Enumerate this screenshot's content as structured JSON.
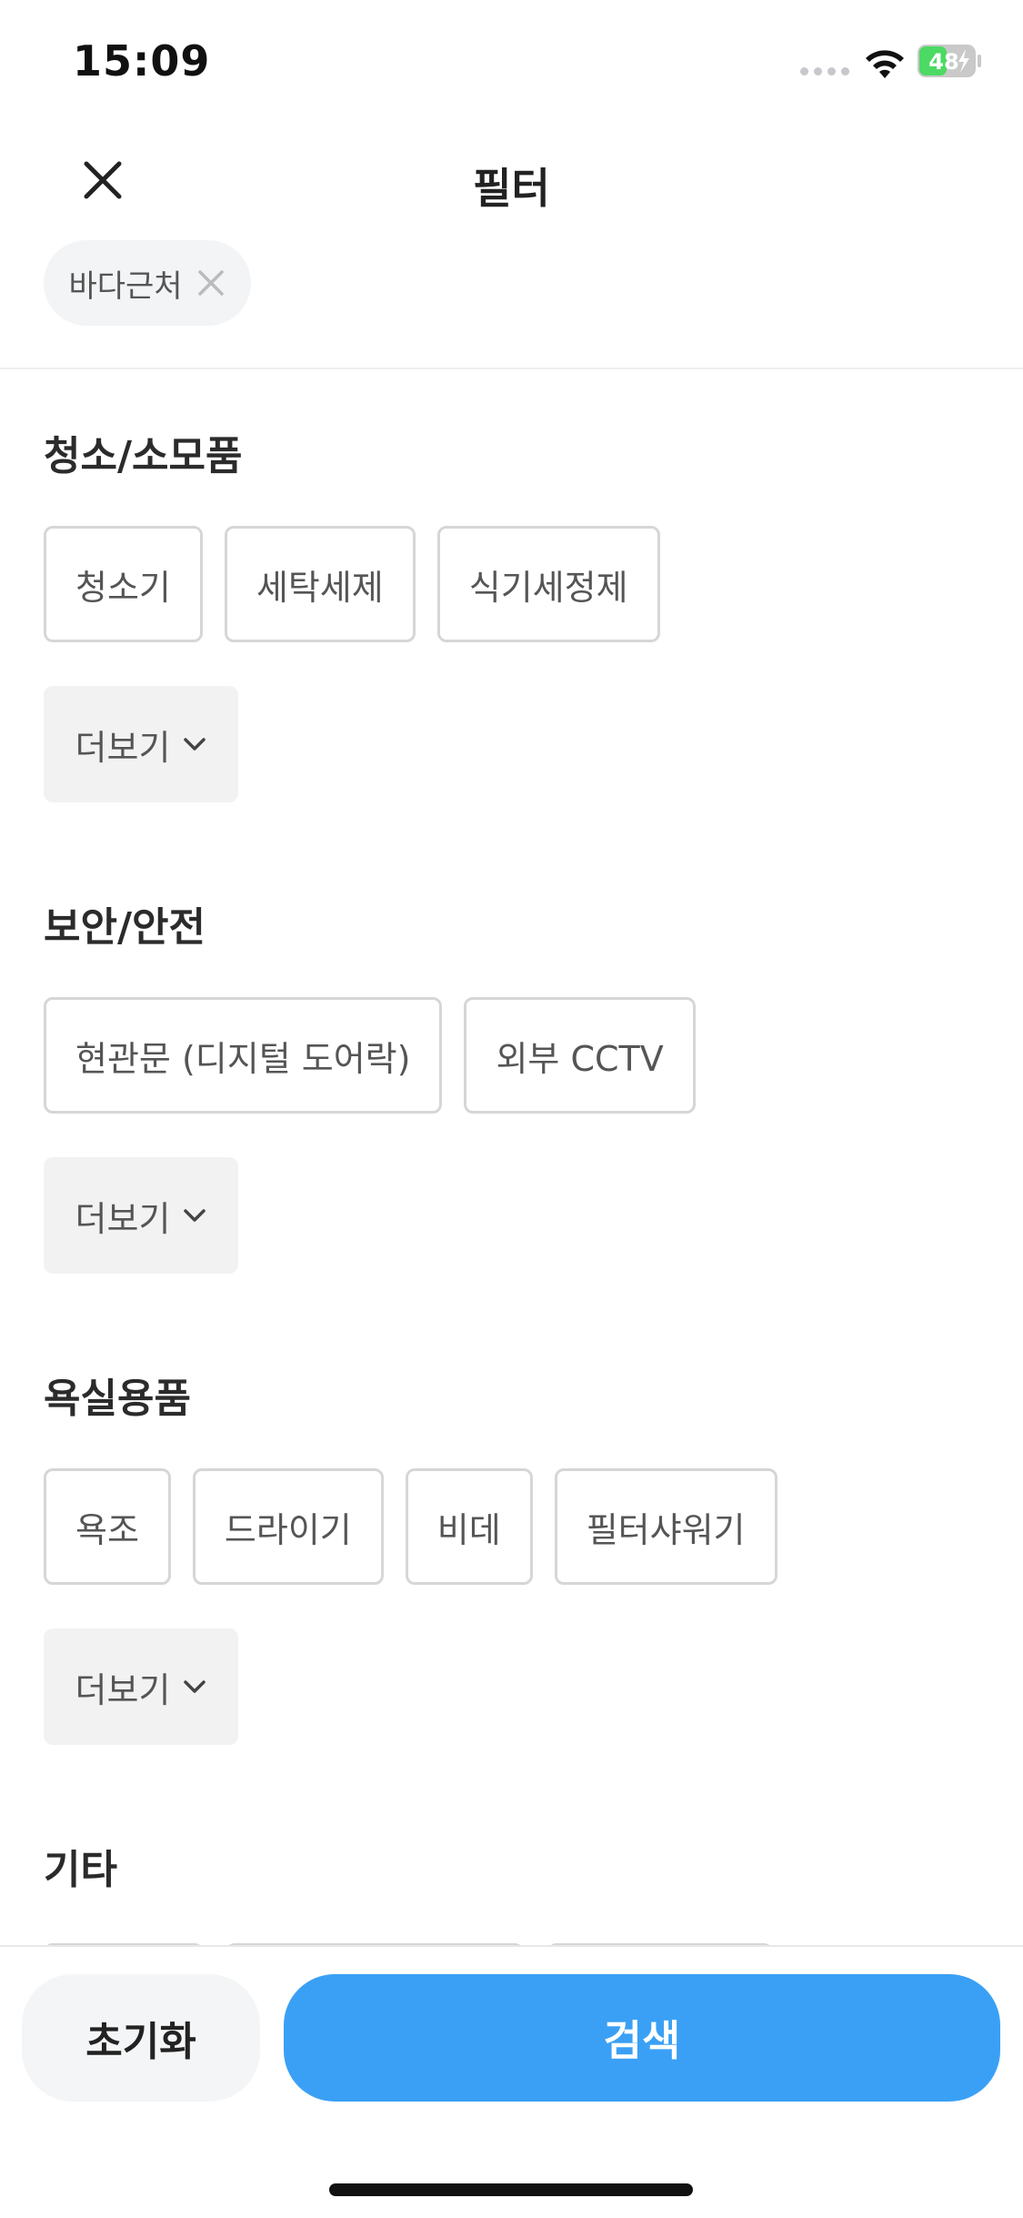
{
  "status_bar": {
    "time": "15:09",
    "battery": "48"
  },
  "header": {
    "title": "필터"
  },
  "selected_filters": [
    {
      "label": "바다근처"
    }
  ],
  "sections": [
    {
      "title": "청소/소모품",
      "chips": [
        "청소기",
        "세탁세제",
        "식기세정제"
      ],
      "more_label": "더보기"
    },
    {
      "title": "보안/안전",
      "chips": [
        "현관문 (디지털 도어락)",
        "외부 CCTV"
      ],
      "more_label": "더보기"
    },
    {
      "title": "욕실용품",
      "chips": [
        "욕조",
        "드라이기",
        "비데",
        "필터샤워기"
      ],
      "more_label": "더보기"
    },
    {
      "title": "기타"
    }
  ],
  "footer": {
    "reset_label": "초기화",
    "search_label": "검색"
  },
  "colors": {
    "accent": "#3aa0f5",
    "chip_border": "#d6d6d6",
    "battery_green": "#4cd964"
  }
}
